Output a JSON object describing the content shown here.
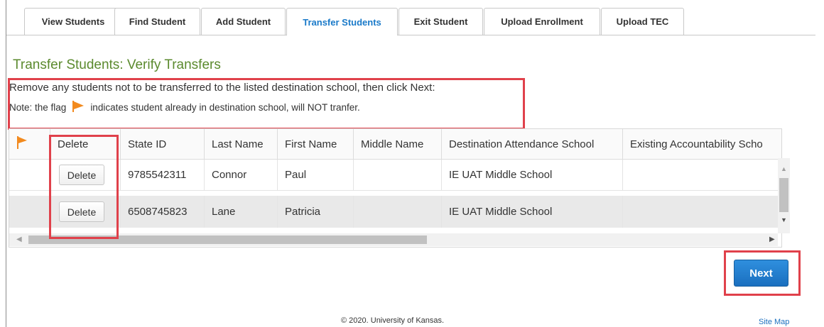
{
  "tabs": [
    {
      "label": "View Students",
      "active": false
    },
    {
      "label": "Find Student",
      "active": false
    },
    {
      "label": "Add Student",
      "active": false
    },
    {
      "label": "Transfer Students",
      "active": true
    },
    {
      "label": "Exit Student",
      "active": false
    },
    {
      "label": "Upload Enrollment",
      "active": false
    },
    {
      "label": "Upload TEC",
      "active": false
    }
  ],
  "page": {
    "title": "Transfer Students: Verify Transfers",
    "instruction": "Remove any students not to be transferred to the listed destination school, then click Next:",
    "note_before": "Note: the flag",
    "note_after": "indicates student already in destination school, will NOT tranfer."
  },
  "table": {
    "columns": [
      "Delete",
      "State ID",
      "Last Name",
      "First Name",
      "Middle Name",
      "Destination Attendance School",
      "Existing Accountability Scho"
    ],
    "rows": [
      {
        "delete_label": "Delete",
        "state_id": "9785542311",
        "last_name": "Connor",
        "first_name": "Paul",
        "middle_name": "",
        "destination": "IE UAT Middle School",
        "existing": ""
      },
      {
        "delete_label": "Delete",
        "state_id": "6508745823",
        "last_name": "Lane",
        "first_name": "Patricia",
        "middle_name": "",
        "destination": "IE UAT Middle School",
        "existing": ""
      }
    ]
  },
  "next_label": "Next",
  "footer": {
    "copyright": "© 2020. University of Kansas.",
    "site_map": "Site Map"
  },
  "icons": {
    "flag": "flag-icon",
    "scroll_up": "chevron-up-icon",
    "scroll_down": "chevron-down-icon",
    "scroll_left": "chevron-left-icon",
    "scroll_right": "chevron-right-icon"
  },
  "colors": {
    "accent": "#1a7ac9",
    "title": "#5b8a2e",
    "highlight": "#e0414b",
    "flag": "#f28a1e",
    "next_button": "#1a6fbf"
  }
}
